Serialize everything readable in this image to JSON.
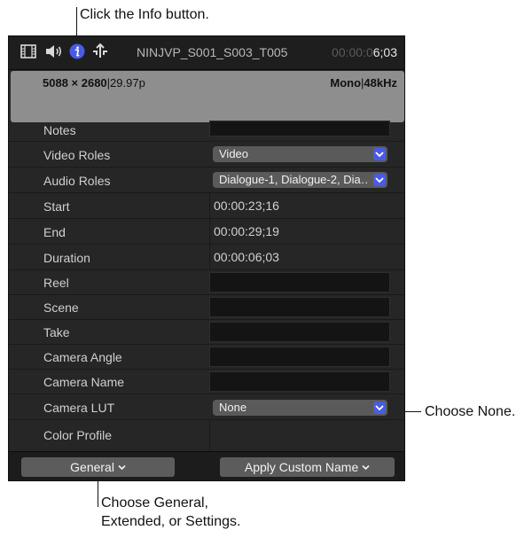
{
  "callouts": {
    "info": "Click the Info button.",
    "none": "Choose None.",
    "general_line1": "Choose General,",
    "general_line2": "Extended, or Settings."
  },
  "toolbar": {
    "icons": [
      "film-icon",
      "speaker-icon",
      "info-icon",
      "share-icon"
    ],
    "clip_name": "NINJVP_S001_S003_T005",
    "timecode_dim": "00:00:0",
    "timecode_bright": "6;03",
    "accent_color": "#4a5be3"
  },
  "header": {
    "resolution": "5088 × 2680",
    "frame_rate": "29.97p",
    "audio_channels": "Mono",
    "sample_rate": "48kHz"
  },
  "rows": [
    {
      "label": "Notes",
      "type": "field"
    },
    {
      "label": "Video Roles",
      "type": "popup",
      "value": "Video"
    },
    {
      "label": "Audio Roles",
      "type": "popup",
      "value": "Dialogue-1, Dialogue-2, Dia…"
    },
    {
      "label": "Start",
      "type": "text",
      "value": "00:00:23;16"
    },
    {
      "label": "End",
      "type": "text",
      "value": "00:00:29;19"
    },
    {
      "label": "Duration",
      "type": "text",
      "value": "00:00:06;03"
    },
    {
      "label": "Reel",
      "type": "field"
    },
    {
      "label": "Scene",
      "type": "field"
    },
    {
      "label": "Take",
      "type": "field"
    },
    {
      "label": "Camera Angle",
      "type": "field"
    },
    {
      "label": "Camera Name",
      "type": "field"
    },
    {
      "label": "Camera LUT",
      "type": "popup",
      "value": "None"
    },
    {
      "label": "Color Profile",
      "type": "text",
      "value": ""
    }
  ],
  "footer": {
    "metadata_view": "General",
    "apply_custom_name": "Apply Custom Name"
  }
}
